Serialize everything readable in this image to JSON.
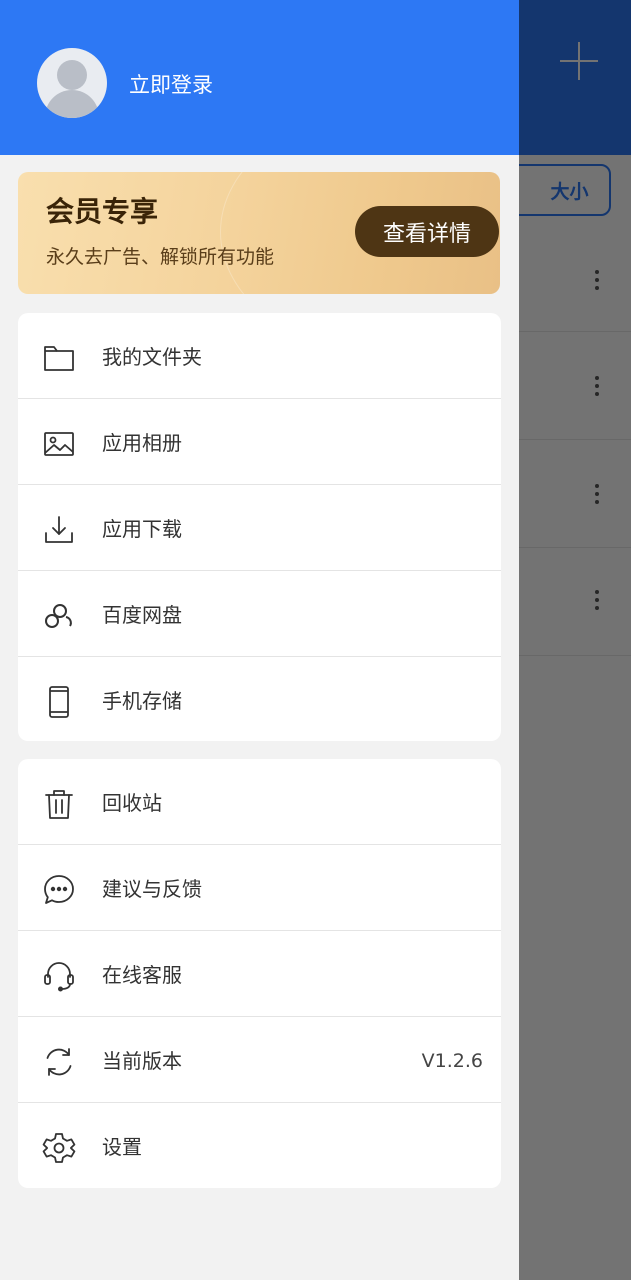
{
  "background": {
    "sort_button_label": "大小"
  },
  "header": {
    "login_label": "立即登录"
  },
  "vip": {
    "title": "会员专享",
    "subtitle": "永久去广告、解锁所有功能",
    "button_label": "查看详情"
  },
  "menu_group_1": [
    {
      "label": "我的文件夹",
      "icon": "folder-icon"
    },
    {
      "label": "应用相册",
      "icon": "image-icon"
    },
    {
      "label": "应用下载",
      "icon": "download-icon"
    },
    {
      "label": "百度网盘",
      "icon": "cloud-disk-icon"
    },
    {
      "label": "手机存储",
      "icon": "phone-icon"
    }
  ],
  "menu_group_2": [
    {
      "label": "回收站",
      "icon": "trash-icon"
    },
    {
      "label": "建议与反馈",
      "icon": "chat-icon"
    },
    {
      "label": "在线客服",
      "icon": "headset-icon"
    },
    {
      "label": "当前版本",
      "icon": "refresh-icon",
      "value": "V1.2.6"
    },
    {
      "label": "设置",
      "icon": "gear-icon"
    }
  ],
  "colors": {
    "primary": "#2d78f4",
    "vip_button": "#4e3514",
    "vip_gold": "#f4d39c"
  }
}
